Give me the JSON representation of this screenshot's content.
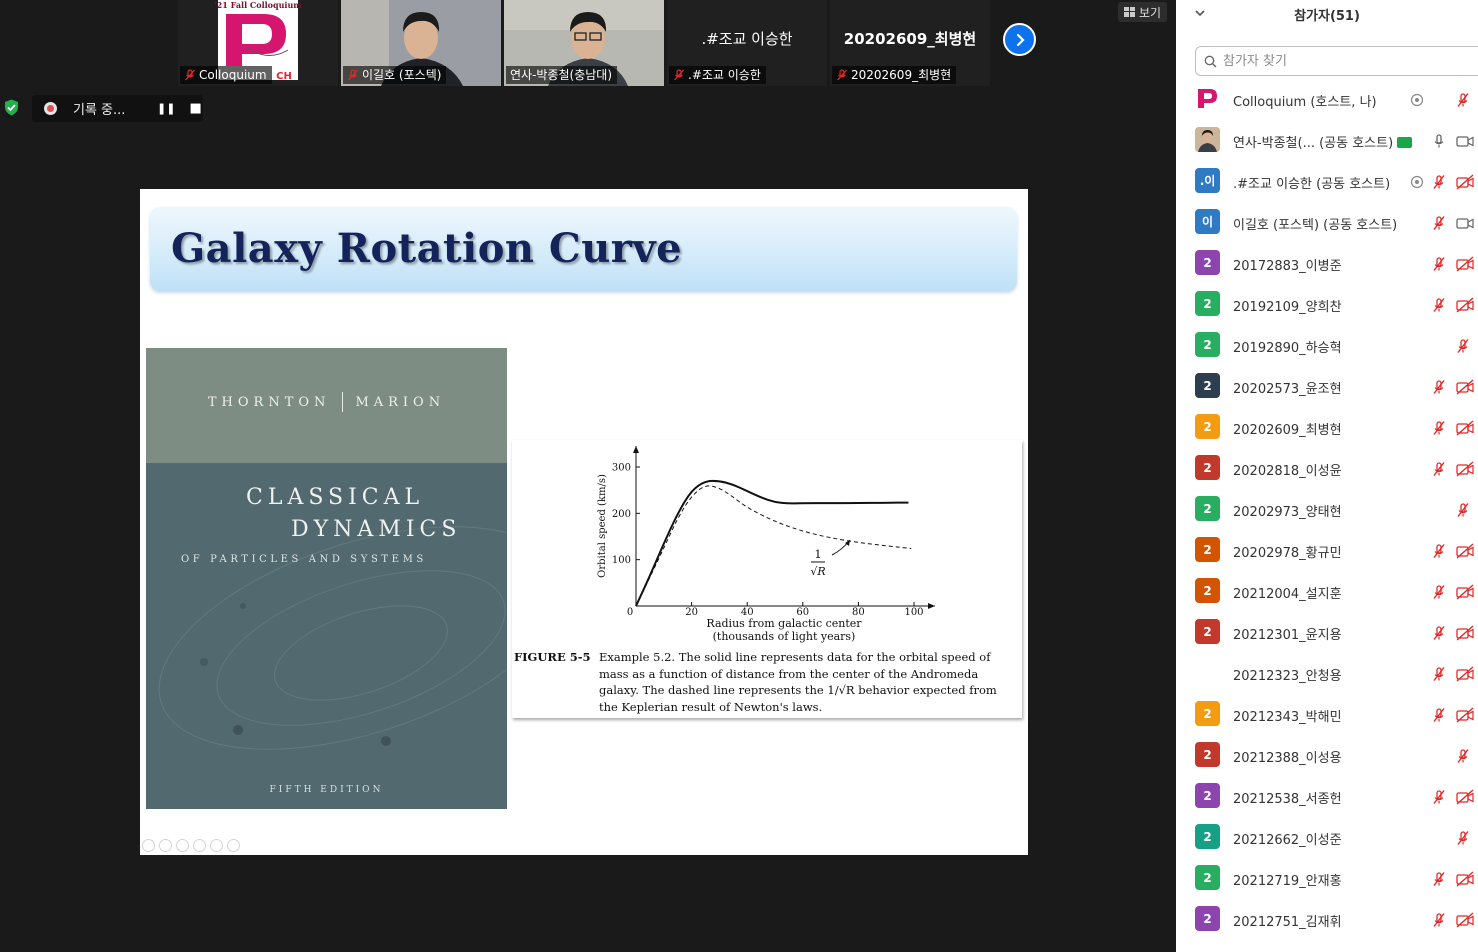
{
  "video_strip": {
    "tiles": [
      {
        "name": "Colloquium",
        "logo_text": "'21 Fall Colloquium",
        "logo_tag": "CH",
        "muted": true
      },
      {
        "name": "이길호 (포스텍)",
        "muted": true
      },
      {
        "name": "연사-박종철(충남대)",
        "muted": false,
        "active": true
      },
      {
        "name": ".#조교 이승한",
        "muted": true
      },
      {
        "name": "20202609_최병현",
        "muted": true
      }
    ],
    "view_label": "보기"
  },
  "recording": {
    "label": "기록 중...",
    "pause": "❚❚",
    "stop": "■"
  },
  "slide": {
    "title": "Galaxy Rotation Curve",
    "book": {
      "authors": [
        "THORNTON",
        "MARION"
      ],
      "title_line1": "CLASSICAL",
      "title_line2": "DYNAMICS",
      "subtitle": "OF PARTICLES AND SYSTEMS",
      "edition": "FIFTH EDITION"
    },
    "figure": {
      "label": "FIGURE 5-5",
      "caption": "Example 5.2. The solid line represents data for the orbital speed of mass as a function of distance from the center of the Andromeda galaxy. The dashed line represents the 1/√R behavior expected from the Keplerian result of Newton's laws."
    }
  },
  "chart_data": {
    "type": "line",
    "xlabel": "Radius from galactic center",
    "xlabel_2": "(thousands of light years)",
    "ylabel": "Orbital speed (km/s)",
    "xlim": [
      0,
      105
    ],
    "ylim": [
      0,
      330
    ],
    "xticks": [
      0,
      20,
      40,
      60,
      80,
      100
    ],
    "yticks": [
      100,
      200,
      300
    ],
    "annotation": {
      "numerator": "1",
      "denominator": "√R"
    },
    "series": [
      {
        "style": "solid",
        "x": [
          0,
          5,
          10,
          15,
          20,
          25,
          30,
          35,
          40,
          45,
          50,
          55,
          60,
          70,
          80,
          90,
          98
        ],
        "y": [
          0,
          65,
          135,
          200,
          250,
          270,
          270,
          262,
          248,
          234,
          224,
          221,
          222,
          222,
          222,
          223,
          223
        ]
      },
      {
        "style": "dashed",
        "x": [
          0,
          5,
          10,
          15,
          20,
          25,
          30,
          35,
          40,
          50,
          60,
          70,
          80,
          90,
          99
        ],
        "y": [
          0,
          62,
          125,
          190,
          238,
          262,
          255,
          235,
          212,
          182,
          161,
          147,
          137,
          130,
          124
        ]
      }
    ]
  },
  "panel": {
    "title": "참가자(51)",
    "search_placeholder": "참가자 찾기",
    "participants": [
      {
        "name": "Colloquium (호스트, 나)",
        "avatar": "",
        "color": "#ffffff",
        "rec": true,
        "mic": "muted",
        "cam": "none"
      },
      {
        "name": "연사-박종철(...   (공동 호스트)",
        "avatar": "",
        "color": "#c9a98a",
        "share": true,
        "mic": "on",
        "cam": "on"
      },
      {
        "name": ".#조교 이승한 (공동 호스트)",
        "avatar": ".이",
        "color": "#2e7bc4",
        "rec": true,
        "mic": "muted",
        "cam": "off"
      },
      {
        "name": "이길호 (포스텍) (공동 호스트)",
        "avatar": "이",
        "color": "#2e7bc4",
        "mic": "muted",
        "cam": "on"
      },
      {
        "name": "20172883_이병준",
        "avatar": "2",
        "color": "#8e44ad",
        "mic": "muted",
        "cam": "off"
      },
      {
        "name": "20192109_양희찬",
        "avatar": "2",
        "color": "#27ae60",
        "mic": "muted",
        "cam": "off"
      },
      {
        "name": "20192890_하승혁",
        "avatar": "2",
        "color": "#27ae60",
        "mic": "none",
        "cam": "muted-only"
      },
      {
        "name": "20202573_윤조현",
        "avatar": "2",
        "color": "#2c3e50",
        "mic": "muted",
        "cam": "off"
      },
      {
        "name": "20202609_최병현",
        "avatar": "2",
        "color": "#f39c12",
        "mic": "muted",
        "cam": "off"
      },
      {
        "name": "20202818_이성윤",
        "avatar": "2",
        "color": "#c0392b",
        "mic": "muted",
        "cam": "off"
      },
      {
        "name": "20202973_양태현",
        "avatar": "2",
        "color": "#27ae60",
        "mic": "none",
        "cam": "muted-only"
      },
      {
        "name": "20202978_황규민",
        "avatar": "2",
        "color": "#d35400",
        "mic": "muted",
        "cam": "off"
      },
      {
        "name": "20212004_설지훈",
        "avatar": "2",
        "color": "#d35400",
        "mic": "muted",
        "cam": "off"
      },
      {
        "name": "20212301_윤지용",
        "avatar": "2",
        "color": "#c0392b",
        "mic": "muted",
        "cam": "off"
      },
      {
        "name": "20212323_안청용",
        "avatar": "",
        "color": "#ffffff",
        "mic": "muted",
        "cam": "off"
      },
      {
        "name": "20212343_박해민",
        "avatar": "2",
        "color": "#f39c12",
        "mic": "muted",
        "cam": "off"
      },
      {
        "name": "20212388_이성용",
        "avatar": "2",
        "color": "#c0392b",
        "mic": "none",
        "cam": "muted-only"
      },
      {
        "name": "20212538_서종헌",
        "avatar": "2",
        "color": "#8e44ad",
        "mic": "muted",
        "cam": "off"
      },
      {
        "name": "20212662_이성준",
        "avatar": "2",
        "color": "#16a085",
        "mic": "none",
        "cam": "muted-only"
      },
      {
        "name": "20212719_안재홍",
        "avatar": "2",
        "color": "#27ae60",
        "mic": "muted",
        "cam": "off"
      },
      {
        "name": "20212751_김재휘",
        "avatar": "2",
        "color": "#8e44ad",
        "mic": "muted",
        "cam": "off"
      }
    ]
  },
  "colors": {
    "zoom_blue": "#0e72ed",
    "mute_red": "#e02828",
    "active_green": "#8bc34a",
    "title_navy": "#14235a"
  },
  "icons": {
    "mute": "mic-muted-icon",
    "cam_off": "camera-off-icon",
    "next": "chevron-right-icon",
    "search": "search-icon",
    "shield": "shield-icon"
  }
}
